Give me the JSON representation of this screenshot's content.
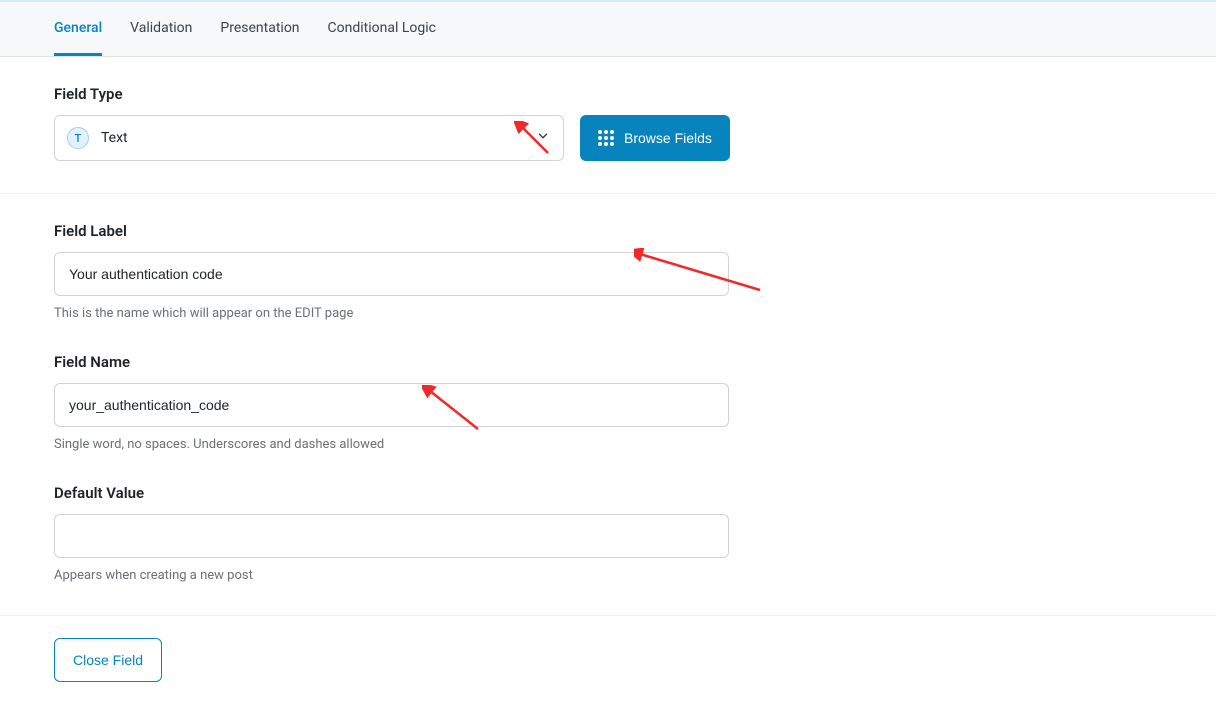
{
  "tabs": {
    "general": "General",
    "validation": "Validation",
    "presentation": "Presentation",
    "conditional": "Conditional Logic",
    "active": "general"
  },
  "field_type": {
    "label": "Field Type",
    "badge_letter": "T",
    "value": "Text",
    "browse_button": "Browse Fields"
  },
  "field_label": {
    "label": "Field Label",
    "value": "Your authentication code",
    "help": "This is the name which will appear on the EDIT page"
  },
  "field_name": {
    "label": "Field Name",
    "value": "your_authentication_code",
    "help": "Single word, no spaces. Underscores and dashes allowed"
  },
  "default_value": {
    "label": "Default Value",
    "value": "",
    "help": "Appears when creating a new post"
  },
  "footer": {
    "close_label": "Close Field"
  }
}
